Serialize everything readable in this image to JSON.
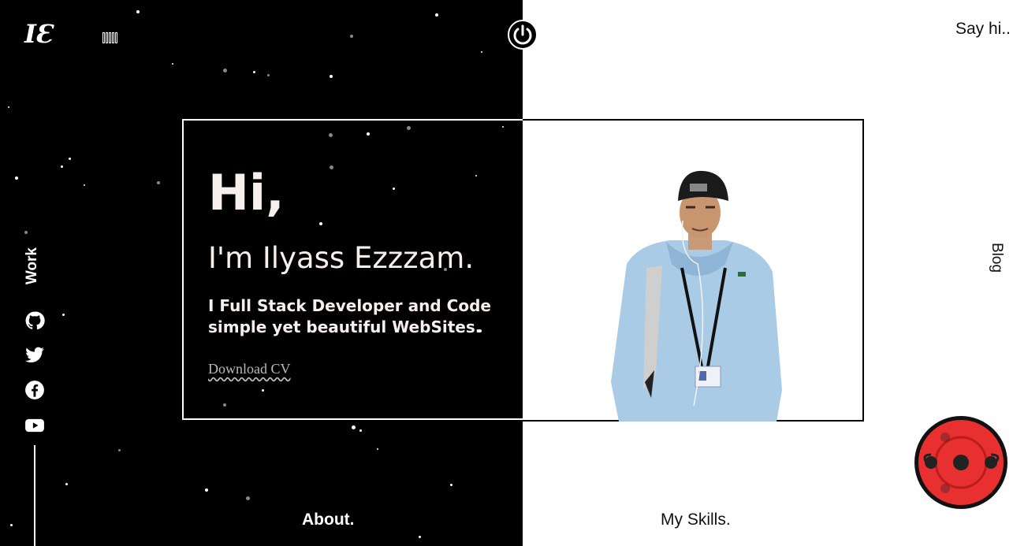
{
  "header": {
    "logo_text": "IƐ",
    "say_hi_label": "Say hi.."
  },
  "nav": {
    "blog_label": "Blog",
    "work_label": "Work",
    "about_label": "About.",
    "skills_label": "My Skills."
  },
  "intro": {
    "greeting": "Hi,",
    "name_line": "I'm Ilyass Ezzzam.",
    "tagline": "I Full Stack Developer and Code simple yet beautiful WebSites.",
    "download_label": "Download CV"
  },
  "social": {
    "icons": [
      "github-icon",
      "twitter-icon",
      "facebook-icon",
      "youtube-icon"
    ]
  },
  "colors": {
    "dark_bg": "#000000",
    "light_bg": "#ffffff",
    "text_light": "#f6efec",
    "accent_red": "#e83030"
  }
}
